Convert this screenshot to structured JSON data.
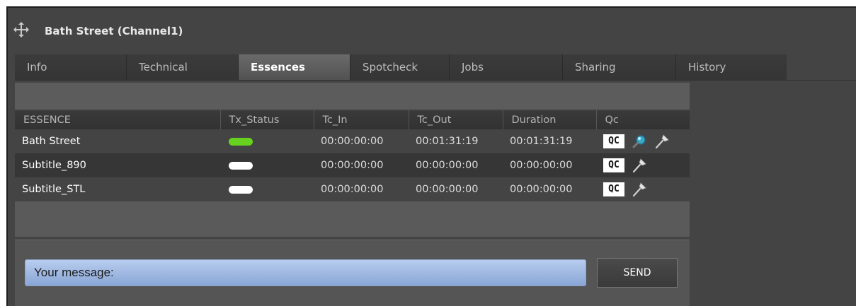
{
  "window": {
    "title": "Bath Street (Channel1)",
    "icon": "move-icon"
  },
  "tabs": [
    {
      "label": "Info",
      "active": false
    },
    {
      "label": "Technical",
      "active": false
    },
    {
      "label": "Essences",
      "active": true
    },
    {
      "label": "Spotcheck",
      "active": false
    },
    {
      "label": "Jobs",
      "active": false
    },
    {
      "label": "Sharing",
      "active": false
    },
    {
      "label": "History",
      "active": false
    }
  ],
  "table": {
    "columns": [
      "ESSENCE",
      "Tx_Status",
      "Tc_In",
      "Tc_Out",
      "Duration",
      "Qc"
    ],
    "rows": [
      {
        "essence": "Bath Street",
        "tx_status": "green",
        "tc_in": "00:00:00:00",
        "tc_out": "00:01:31:19",
        "duration": "00:01:31:19",
        "qc_label": "QC",
        "icons": [
          "magnifier-icon",
          "pin-icon"
        ]
      },
      {
        "essence": "Subtitle_890",
        "tx_status": "white",
        "tc_in": "00:00:00:00",
        "tc_out": "00:00:00:00",
        "duration": "00:00:00:00",
        "qc_label": "QC",
        "icons": [
          "pin-icon"
        ]
      },
      {
        "essence": "Subtitle_STL",
        "tx_status": "white",
        "tc_in": "00:00:00:00",
        "tc_out": "00:00:00:00",
        "duration": "00:00:00:00",
        "qc_label": "QC",
        "icons": [
          "pin-icon"
        ]
      }
    ]
  },
  "message": {
    "placeholder": "Your message:",
    "value": "",
    "send_label": "SEND"
  },
  "colors": {
    "status_green": "#66d11f",
    "status_white": "#ffffff",
    "input_blue": "#9fb9e3"
  }
}
